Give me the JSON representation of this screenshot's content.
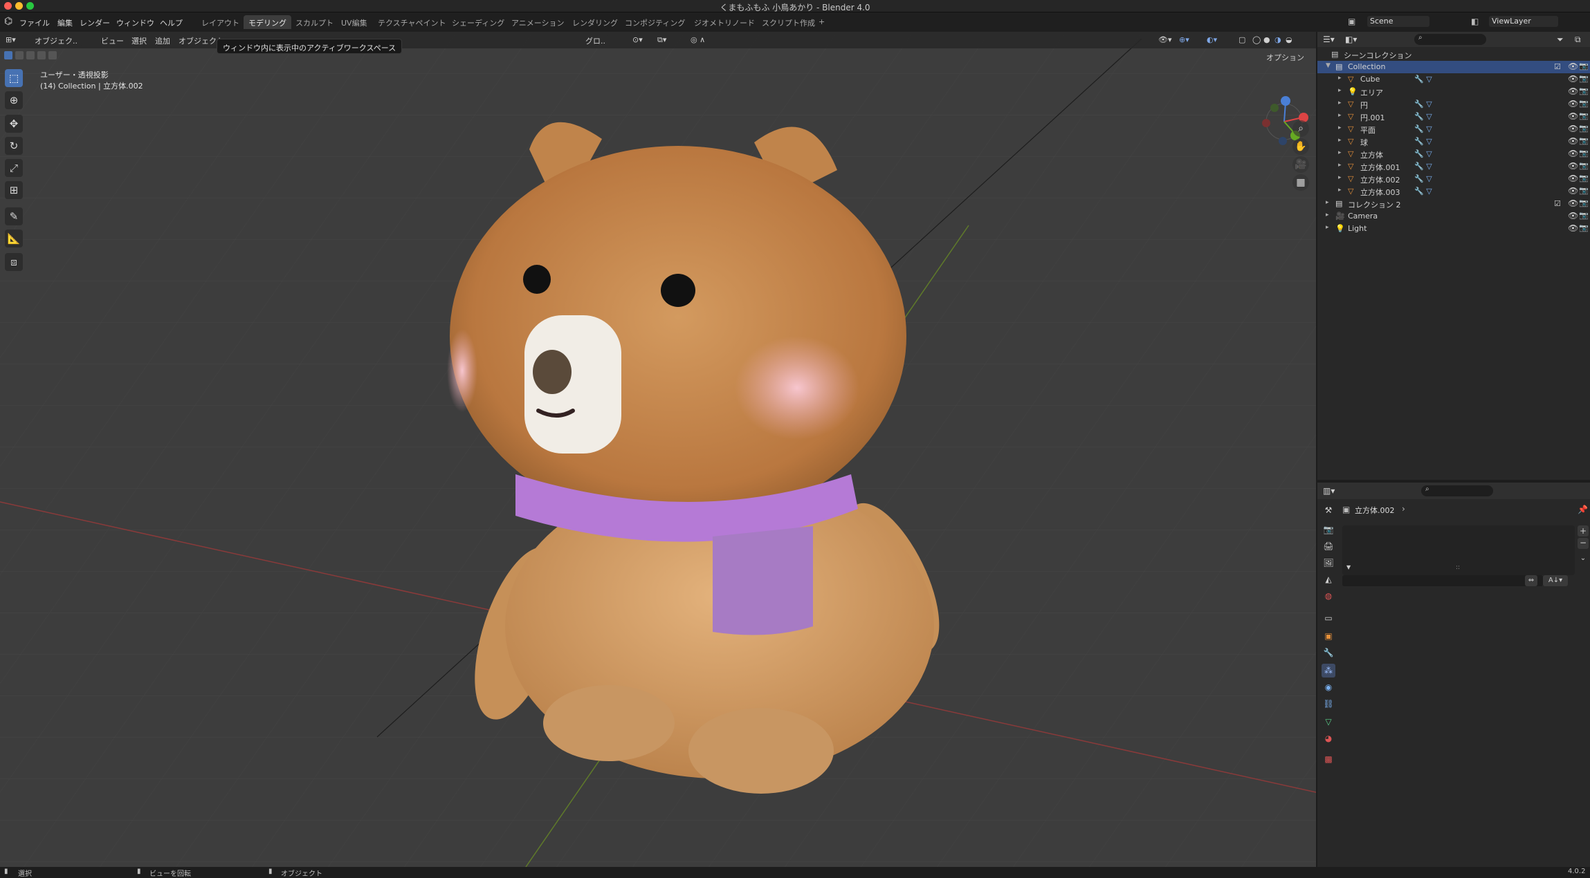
{
  "window": {
    "title": "くまもふもふ 小鳥あかり - Blender 4.0"
  },
  "menu": {
    "items": [
      "ファイル",
      "編集",
      "レンダー",
      "ウィンドウ",
      "ヘルプ"
    ]
  },
  "workspaces": {
    "tabs": [
      "レイアウト",
      "モデリング",
      "スカルプト",
      "UV編集",
      "テクスチャペイント",
      "シェーディング",
      "アニメーション",
      "レンダリング",
      "コンポジティング",
      "ジオメトリノード",
      "スクリプト作成"
    ],
    "active": "モデリング",
    "add": "+"
  },
  "scene": {
    "name": "Scene",
    "view_layer": "ViewLayer"
  },
  "viewport": {
    "header": {
      "mode": "オブジェク..",
      "view": "ビュー",
      "select": "選択",
      "add": "追加",
      "object": "オブジェクト",
      "transform": "グロ..",
      "options": "オプション"
    },
    "overlay_text": {
      "view_name": "ユーザー・透視投影",
      "context": "(14) Collection | 立方体.002"
    },
    "tooltip": "ウィンドウ内に表示中のアクティブワークスペース"
  },
  "tools": [
    "select-box",
    "cursor",
    "move",
    "rotate",
    "scale",
    "transform",
    "annotate",
    "measure",
    "add-cube"
  ],
  "outliner": {
    "root": "シーンコレクション",
    "rows": [
      {
        "label": "Collection",
        "level": 1,
        "kind": "collection",
        "selected": true
      },
      {
        "label": "Cube",
        "level": 2,
        "kind": "mesh"
      },
      {
        "label": "エリア",
        "level": 2,
        "kind": "light"
      },
      {
        "label": "円",
        "level": 2,
        "kind": "mesh"
      },
      {
        "label": "円.001",
        "level": 2,
        "kind": "mesh"
      },
      {
        "label": "平面",
        "level": 2,
        "kind": "mesh"
      },
      {
        "label": "球",
        "level": 2,
        "kind": "mesh"
      },
      {
        "label": "立方体",
        "level": 2,
        "kind": "mesh"
      },
      {
        "label": "立方体.001",
        "level": 2,
        "kind": "mesh"
      },
      {
        "label": "立方体.002",
        "level": 2,
        "kind": "mesh"
      },
      {
        "label": "立方体.003",
        "level": 2,
        "kind": "mesh"
      },
      {
        "label": "コレクション 2",
        "level": 1,
        "kind": "collection"
      },
      {
        "label": "Camera",
        "level": 1,
        "kind": "camera"
      },
      {
        "label": "Light",
        "level": 1,
        "kind": "light"
      }
    ]
  },
  "properties": {
    "object": "立方体.002",
    "list_label": "::"
  },
  "status": {
    "left": "選択",
    "middle": "ビューを回転",
    "right": "オブジェクト",
    "version": "4.0.2"
  },
  "colors": {
    "accent": "#4772b3",
    "viewport_bg": "#3d3d3d",
    "fur": "#c68a4e",
    "scarf": "#b57ad6"
  }
}
